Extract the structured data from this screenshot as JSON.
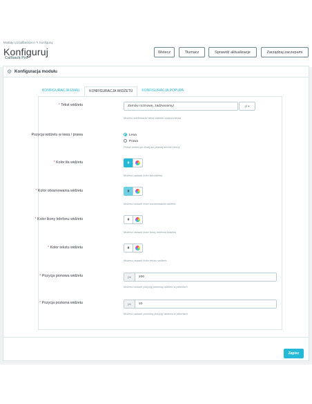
{
  "header": {
    "breadcrumb": "Moduły  /  pzcallbackpro  /  ✎ Konfiguruj",
    "title": "Konfiguruj",
    "subtitle": "Callback Pro",
    "buttons": {
      "back": "Wstecz",
      "translate": "Tłumacz",
      "check_update": "Sprawdź aktualizacje",
      "manage_hooks": "Zarządzaj zaczepami"
    }
  },
  "panel": {
    "title": "Konfiguracja modułu",
    "icon": "cogs-icon",
    "tabs": [
      "KONFIGURACJA EMAIL",
      "KONFIGURACJA WIDŻETU",
      "KONFIGURACJA POPUPA"
    ],
    "active_tab": "KONFIGURACJA WIDŻETU"
  },
  "form": {
    "widget_text": {
      "label": "Tekst widżetu",
      "value": "Zamów rozmowę, zadzwonimy!",
      "lang": "pl ▾",
      "help": "Możesz zdefiniować tekst widżetu zadzwonienia"
    },
    "widget_position": {
      "label": "Pozycja widżetu w lewa / prawa",
      "options": [
        "Lewa",
        "Prawa"
      ],
      "selected": "Lewa",
      "help": "Pokaż widżet po lewej lub prawej stronie strony"
    },
    "bg_color": {
      "label": "Kolor tła widżetu",
      "hash": "#",
      "color": "#25b9d7",
      "help": "Możesz ustawić kolor tła widżetu"
    },
    "border_color": {
      "label": "Kolor obramowania widżetu",
      "hash": "#",
      "color": "#6fcfe3",
      "help": "Możesz ustawić kolor obramowania widżetu"
    },
    "phone_icon_color": {
      "label": "Kolor ikony telefonu widżetu",
      "hash": "#",
      "color": "#ffffff",
      "help": "Możesz ustawić kolor ikony telefonu widżetu"
    },
    "text_color": {
      "label": "Kolor tekstu widżetu",
      "hash": "#",
      "color": "#ffffff",
      "help": "Możesz ustawić kolor tekstu widżetu"
    },
    "vertical_pos": {
      "label": "Pozycja pionowa widżetu",
      "unit": "px",
      "value": "200",
      "help": "Możesz ustawić pozycję pionową widżetu w pikselach"
    },
    "horizontal_pos": {
      "label": "Pozycja pozioma widżetu",
      "unit": "px",
      "value": "10",
      "help": "Możesz ustawić poziomą pozycję widżetu w pikselach"
    },
    "required_mark": "*"
  },
  "footer": {
    "save": "Zapisz"
  },
  "colors": {
    "accent": "#25b9d7",
    "required": "#c05c67"
  }
}
